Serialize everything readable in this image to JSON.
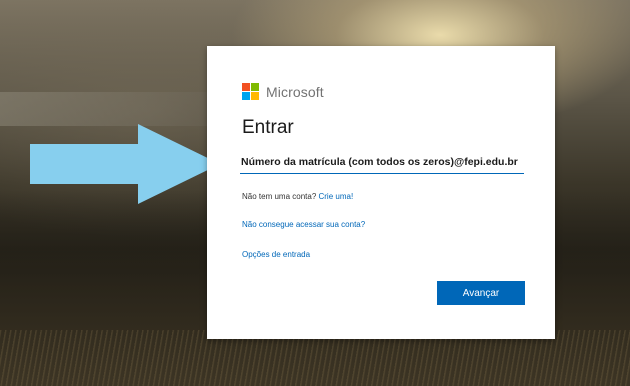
{
  "brand": {
    "name": "Microsoft",
    "logo_colors": [
      "#f25022",
      "#7fba00",
      "#00a4ef",
      "#ffb900"
    ]
  },
  "signin": {
    "title": "Entrar",
    "email_value": "Número da matrícula (com todos os zeros)@fepi.edu.br",
    "no_account_text": "Não tem uma conta?",
    "create_link": "Crie uma!",
    "cant_access_link": "Não consegue acessar sua conta?",
    "signin_options_link": "Opções de entrada",
    "next_button": "Avançar"
  },
  "colors": {
    "accent": "#0067b8",
    "arrow": "#87cfee"
  },
  "icons": {
    "annotation": "arrow-right-icon"
  }
}
